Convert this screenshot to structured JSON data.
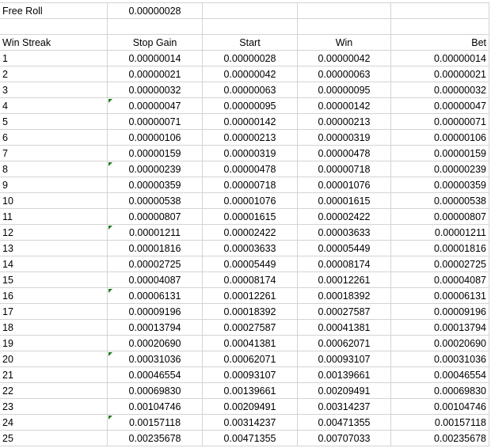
{
  "free_roll": {
    "label": "Free Roll",
    "value": "0.00000028"
  },
  "headers": [
    "Win Streak",
    "Stop Gain",
    "Start",
    "Win",
    "Bet"
  ],
  "flagged_rows": [
    4,
    8,
    12,
    16,
    20,
    24
  ],
  "flag_color": "#1e7a1e",
  "rows": [
    [
      "1",
      "0.00000014",
      "0.00000028",
      "0.00000042",
      "0.00000014"
    ],
    [
      "2",
      "0.00000021",
      "0.00000042",
      "0.00000063",
      "0.00000021"
    ],
    [
      "3",
      "0.00000032",
      "0.00000063",
      "0.00000095",
      "0.00000032"
    ],
    [
      "4",
      "0.00000047",
      "0.00000095",
      "0.00000142",
      "0.00000047"
    ],
    [
      "5",
      "0.00000071",
      "0.00000142",
      "0.00000213",
      "0.00000071"
    ],
    [
      "6",
      "0.00000106",
      "0.00000213",
      "0.00000319",
      "0.00000106"
    ],
    [
      "7",
      "0.00000159",
      "0.00000319",
      "0.00000478",
      "0.00000159"
    ],
    [
      "8",
      "0.00000239",
      "0.00000478",
      "0.00000718",
      "0.00000239"
    ],
    [
      "9",
      "0.00000359",
      "0.00000718",
      "0.00001076",
      "0.00000359"
    ],
    [
      "10",
      "0.00000538",
      "0.00001076",
      "0.00001615",
      "0.00000538"
    ],
    [
      "11",
      "0.00000807",
      "0.00001615",
      "0.00002422",
      "0.00000807"
    ],
    [
      "12",
      "0.00001211",
      "0.00002422",
      "0.00003633",
      "0.00001211"
    ],
    [
      "13",
      "0.00001816",
      "0.00003633",
      "0.00005449",
      "0.00001816"
    ],
    [
      "14",
      "0.00002725",
      "0.00005449",
      "0.00008174",
      "0.00002725"
    ],
    [
      "15",
      "0.00004087",
      "0.00008174",
      "0.00012261",
      "0.00004087"
    ],
    [
      "16",
      "0.00006131",
      "0.00012261",
      "0.00018392",
      "0.00006131"
    ],
    [
      "17",
      "0.00009196",
      "0.00018392",
      "0.00027587",
      "0.00009196"
    ],
    [
      "18",
      "0.00013794",
      "0.00027587",
      "0.00041381",
      "0.00013794"
    ],
    [
      "19",
      "0.00020690",
      "0.00041381",
      "0.00062071",
      "0.00020690"
    ],
    [
      "20",
      "0.00031036",
      "0.00062071",
      "0.00093107",
      "0.00031036"
    ],
    [
      "21",
      "0.00046554",
      "0.00093107",
      "0.00139661",
      "0.00046554"
    ],
    [
      "22",
      "0.00069830",
      "0.00139661",
      "0.00209491",
      "0.00069830"
    ],
    [
      "23",
      "0.00104746",
      "0.00209491",
      "0.00314237",
      "0.00104746"
    ],
    [
      "24",
      "0.00157118",
      "0.00314237",
      "0.00471355",
      "0.00157118"
    ],
    [
      "25",
      "0.00235678",
      "0.00471355",
      "0.00707033",
      "0.00235678"
    ]
  ]
}
